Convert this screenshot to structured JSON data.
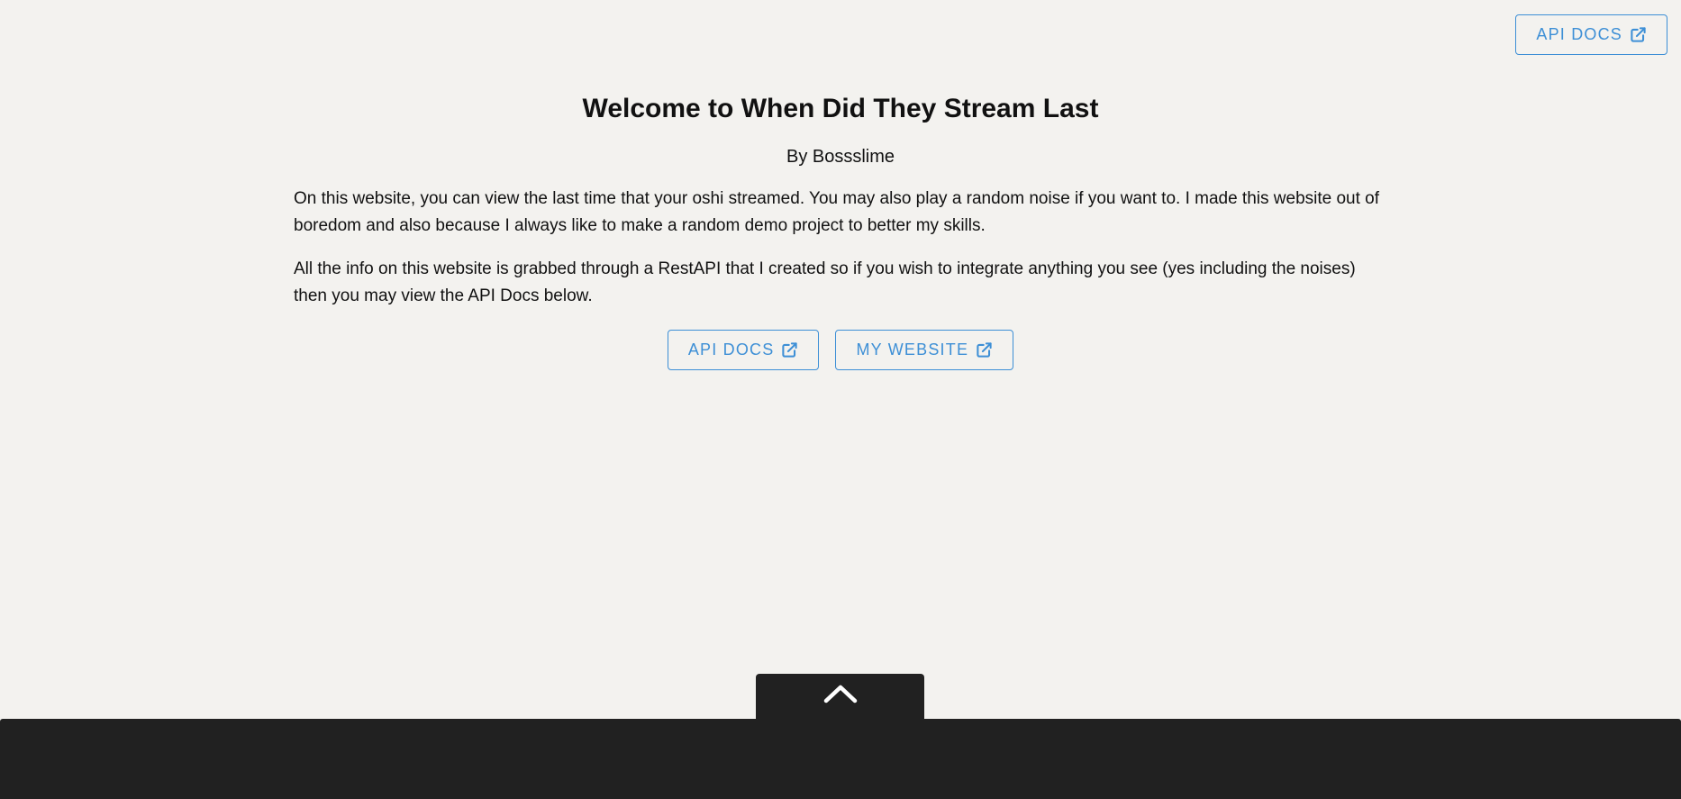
{
  "header": {
    "api_docs_label": "API DOCS",
    "external_icon": "external-link-icon"
  },
  "hero": {
    "title": "Welcome to When Did They Stream Last",
    "byline": "By Bossslime",
    "paragraphs": [
      "On this website, you can view the last time that your oshi streamed. You may also play a random noise if you want to. I made this website out of boredom and also because I always like to make a random demo project to better my skills.",
      "All the info on this website is grabbed through a RestAPI that I created so if you wish to integrate anything you see (yes including the noises) then you may view the API Docs below."
    ],
    "buttons": [
      {
        "label": "API DOCS",
        "icon": "external-link-icon"
      },
      {
        "label": "MY WEBSITE",
        "icon": "external-link-icon"
      }
    ]
  },
  "drawer": {
    "toggle_icon": "chevron-up-icon"
  },
  "colors": {
    "background": "#f3f2ef",
    "accent": "#3d8fd6",
    "drawer": "#212121",
    "text": "#111111"
  }
}
